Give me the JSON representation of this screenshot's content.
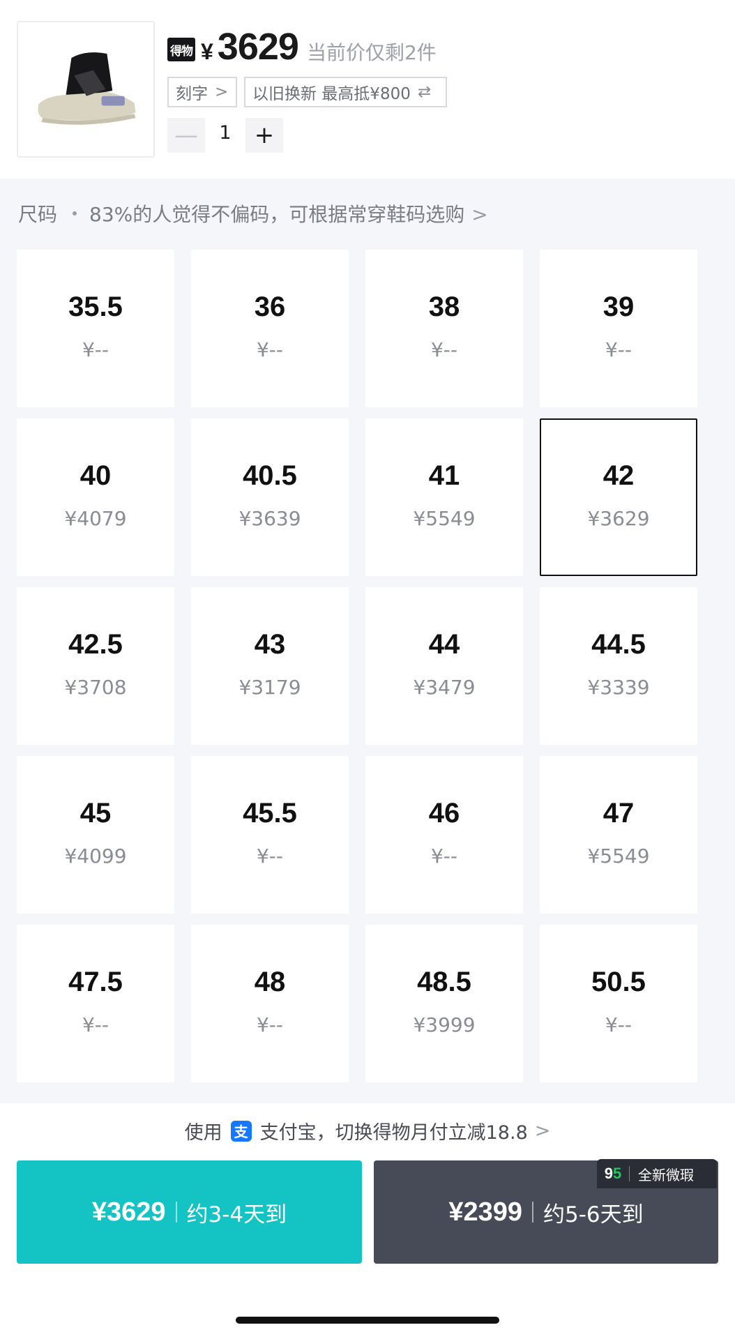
{
  "product": {
    "brand": "得物",
    "currency": "¥",
    "price": "3629",
    "stock_note": "当前价仅剩2件",
    "image_icon": "sneaker-icon"
  },
  "tags": {
    "engrave": "刻字",
    "engrave_icon": ">",
    "tradein": "以旧换新 最高抵¥800",
    "tradein_icon": "⇄"
  },
  "quantity": {
    "minus": "—",
    "value": "1",
    "plus": "+"
  },
  "size_hint": {
    "label": "尺码",
    "text": "83%的人觉得不偏码，可根据常穿鞋码选购",
    "arrow": ">"
  },
  "sizes": [
    {
      "size": "35.5",
      "price": "¥--"
    },
    {
      "size": "36",
      "price": "¥--"
    },
    {
      "size": "38",
      "price": "¥--"
    },
    {
      "size": "39",
      "price": "¥--"
    },
    {
      "size": "40",
      "price": "¥4079"
    },
    {
      "size": "40.5",
      "price": "¥3639"
    },
    {
      "size": "41",
      "price": "¥5549"
    },
    {
      "size": "42",
      "price": "¥3629",
      "selected": true
    },
    {
      "size": "42.5",
      "price": "¥3708"
    },
    {
      "size": "43",
      "price": "¥3179"
    },
    {
      "size": "44",
      "price": "¥3479"
    },
    {
      "size": "44.5",
      "price": "¥3339"
    },
    {
      "size": "45",
      "price": "¥4099"
    },
    {
      "size": "45.5",
      "price": "¥--"
    },
    {
      "size": "46",
      "price": "¥--"
    },
    {
      "size": "47",
      "price": "¥5549"
    },
    {
      "size": "47.5",
      "price": "¥--"
    },
    {
      "size": "48",
      "price": "¥--"
    },
    {
      "size": "48.5",
      "price": "¥3999"
    },
    {
      "size": "50.5",
      "price": "¥--"
    }
  ],
  "payment": {
    "prefix": "使用",
    "icon": "支",
    "text": "支付宝，切换得物月付立减18.8",
    "arrow": ">"
  },
  "buy_new": {
    "price": "¥3629",
    "delivery": "约3-4天到"
  },
  "buy_used": {
    "price": "¥2399",
    "delivery": "约5-6天到",
    "badge_logo_a": "9",
    "badge_logo_b": "5",
    "badge_text": "全新微瑕"
  },
  "colors": {
    "primary": "#14c3c3",
    "secondary": "#474a57",
    "alipay": "#1677ff"
  }
}
